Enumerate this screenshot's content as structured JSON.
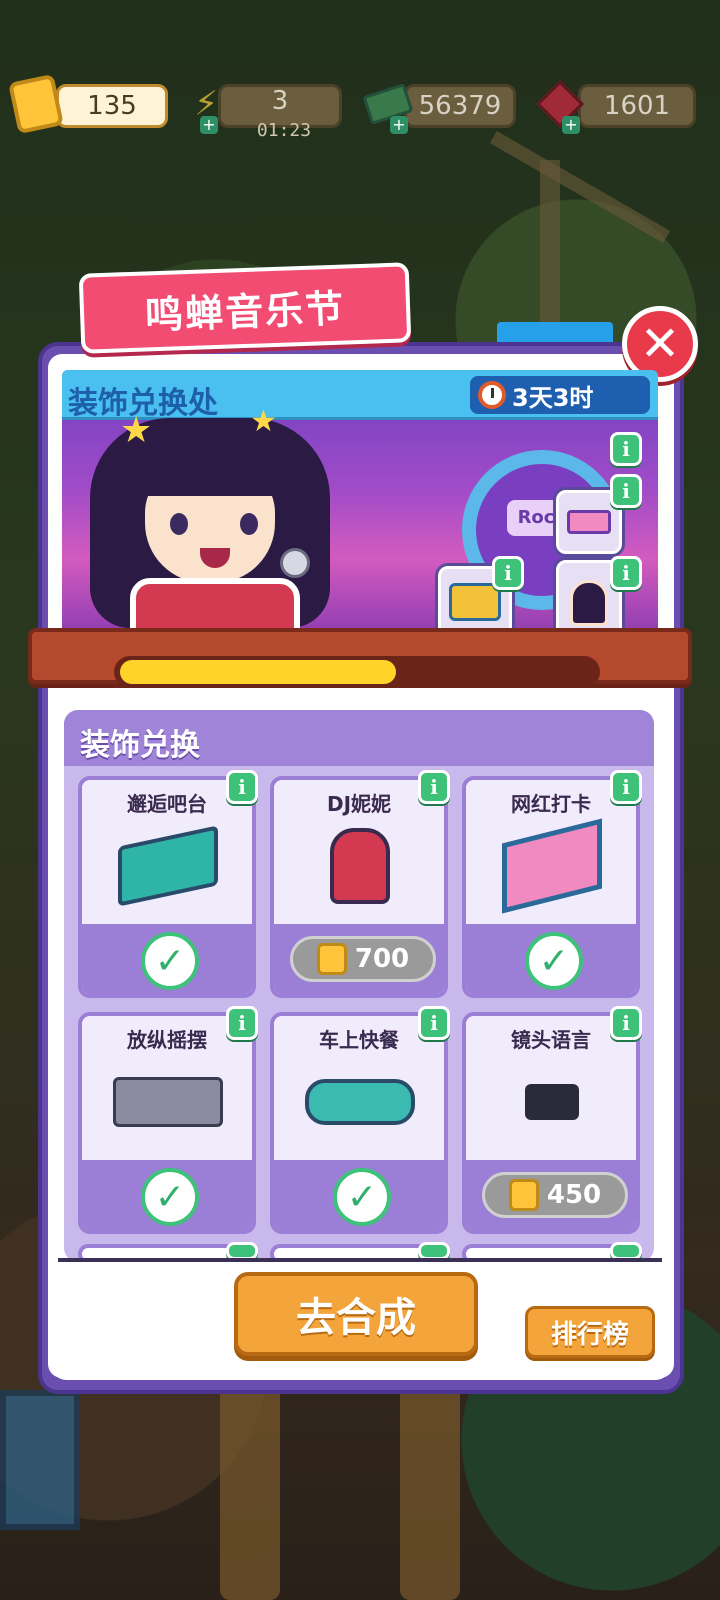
{
  "resources": [
    {
      "name": "ticket",
      "value": "135",
      "icon": "ticket-icon",
      "primary": true
    },
    {
      "name": "energy",
      "value": "3",
      "icon": "lightning-icon",
      "timer": "01:23"
    },
    {
      "name": "cash",
      "value": "56379",
      "icon": "cash-icon"
    },
    {
      "name": "gem",
      "value": "1601",
      "icon": "gem-icon"
    }
  ],
  "event": {
    "title": "鸣蝉音乐节",
    "banner_title": "装饰兑换处",
    "time_left": "3天3时",
    "stage_sign": "Rock",
    "progress": 0.58
  },
  "section": {
    "title": "装饰兑换"
  },
  "items": [
    {
      "name": "邂逅吧台",
      "status": "owned",
      "icon": "bar-counter-icon"
    },
    {
      "name": "DJ妮妮",
      "status": "price",
      "price": "700",
      "icon": "dj-icon"
    },
    {
      "name": "网红打卡",
      "status": "owned",
      "icon": "photo-booth-icon"
    },
    {
      "name": "放纵摇摆",
      "status": "owned",
      "icon": "crowd-icon"
    },
    {
      "name": "车上快餐",
      "status": "owned",
      "icon": "car-icon"
    },
    {
      "name": "镜头语言",
      "status": "price",
      "price": "450",
      "icon": "camera-icon"
    }
  ],
  "buttons": {
    "go": "去合成",
    "rank": "排行榜"
  },
  "colors": {
    "accent_pink": "#f24c73",
    "panel_purple": "#6b4fb0",
    "button_orange": "#f3a43a",
    "check_green": "#3ec27a"
  }
}
